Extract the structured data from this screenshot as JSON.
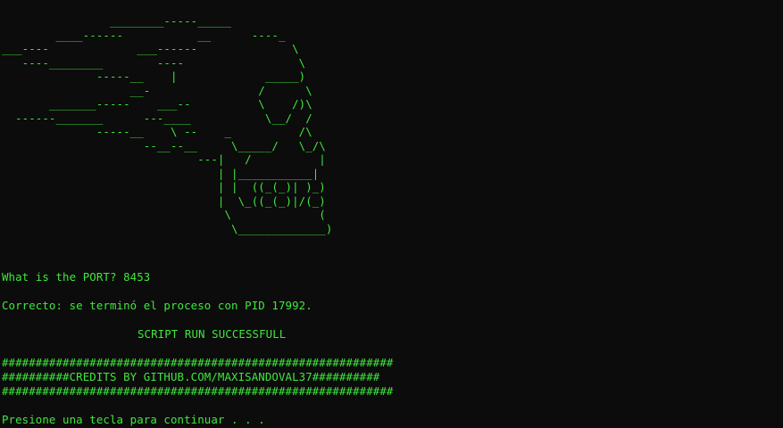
{
  "terminal": {
    "ascii_art": "                ________-----_____\n        ____------           __      ----_\n___----             ___------              \\\n   ----________        ----                 \\\n              -----__    |             _____)\n                   __-                /      \\\n       _______-----    ___--          \\    /)\\\n  ------_______      ---____           \\__/  /\n              -----__    \\ --    _          /\\\n                     --__--__     \\_____/   \\_/\\\n                             ---|   /          |\n                                | |___________|\n                                | |  ((_(_)| )_)\n                                |  \\_((_(_)|/(_)\n                                 \\             (\n                                  \\_____________)",
    "port_prompt": "What is the PORT? 8453",
    "result_message": "Correcto: se terminó el proceso con PID 17992.",
    "success_message": "SCRIPT RUN SUCCESSFULL",
    "credits_line_1": "##########################################################",
    "credits_line_2": "##########CREDITS BY GITHUB.COM/MAXISANDOVAL37##########",
    "credits_line_3": "##########################################################",
    "continue_message": "Presione una tecla para continuar . . ."
  }
}
